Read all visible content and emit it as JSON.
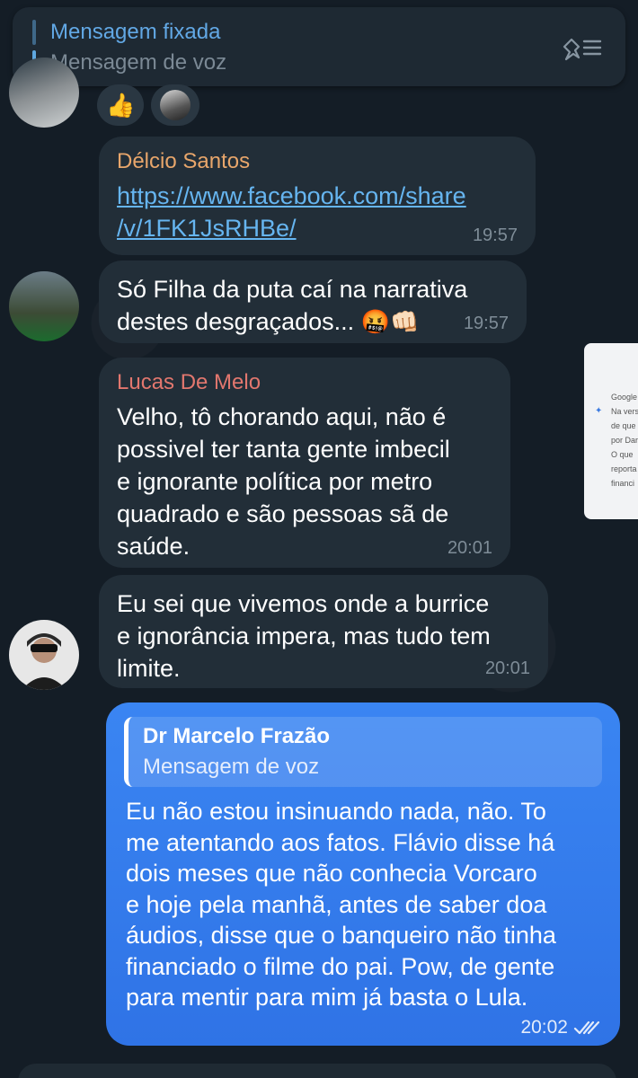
{
  "pinned": {
    "title": "Mensagem fixada",
    "subtitle": "Mensagem de voz",
    "icon": "pin-list-icon"
  },
  "reactions": [
    {
      "emoji": "👍"
    }
  ],
  "messages": [
    {
      "sender": "Délcio Santos",
      "sender_color": "#e8a66b",
      "link_line1": "https://www.facebook.com/share",
      "link_line2": "/v/1FK1JsRHBe/",
      "time": "19:57"
    },
    {
      "text_line1": "Só Filha da puta caí na narrativa",
      "text_line2": "destes desgraçados...",
      "emoji": "🤬👊🏻",
      "time": "19:57"
    },
    {
      "sender": "Lucas De Melo",
      "sender_color": "#e2776e",
      "lines": [
        "Velho, tô chorando aqui, não é",
        "possivel ter tanta gente imbecil",
        "e ignorante política por metro",
        "quadrado e são pessoas sã de",
        "saúde."
      ],
      "time": "20:01"
    },
    {
      "lines": [
        "Eu sei que vivemos onde a burrice",
        "e ignorância impera, mas tudo tem",
        "limite."
      ],
      "time": "20:01"
    }
  ],
  "own_message": {
    "reply_title": "Dr Marcelo Frazão",
    "reply_subtitle": "Mensagem de voz",
    "lines": [
      "Eu não estou insinuando nada, não. To",
      "me atentando aos fatos. Flávio disse há",
      "dois meses que não conhecia Vorcaro",
      "e hoje pela manhã, antes de saber doa",
      "áudios, disse que o banqueiro não tinha",
      "financiado o filme do pai. Pow, de gente",
      "para mentir para mim já basta o Lula."
    ],
    "time": "20:02",
    "status": "read"
  },
  "side_card": {
    "lines": [
      "Google S",
      "Na vers",
      "de que",
      "por Dar",
      "O que",
      "reporta",
      "financi"
    ]
  },
  "colors": {
    "accent": "#62a8e5",
    "own_bubble": "#3a85f2",
    "bubble": "#222e38",
    "background": "#141d26"
  }
}
